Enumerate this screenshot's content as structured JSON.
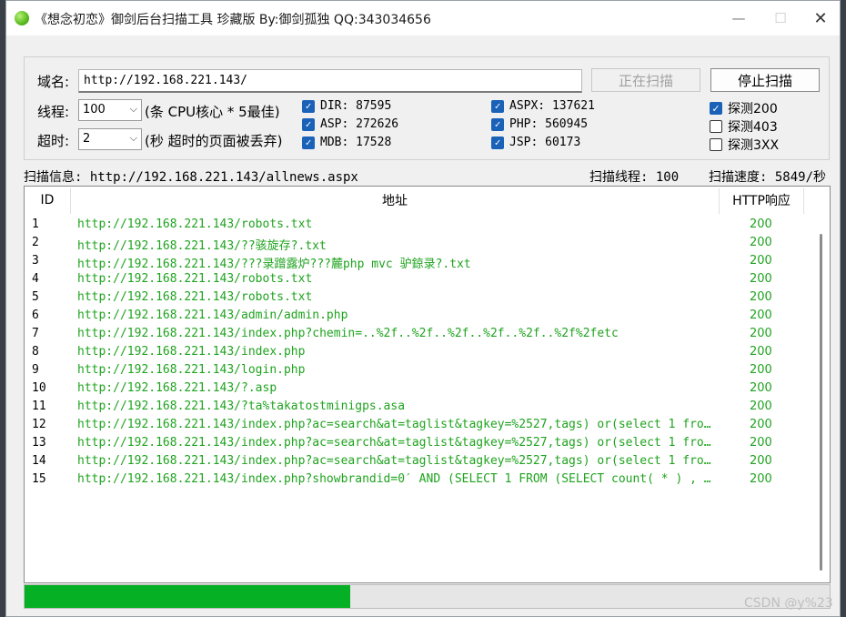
{
  "window": {
    "title": "《想念初恋》御剑后台扫描工具 珍藏版 By:御剑孤独 QQ:343034656",
    "min_symbol": "—",
    "max_symbol": "☐",
    "close_symbol": "✕"
  },
  "form": {
    "domain_label": "域名:",
    "domain_value": "http://192.168.221.143/",
    "scan_button": "正在扫描",
    "stop_button": "停止扫描",
    "threads_label": "线程:",
    "threads_value": "100",
    "threads_hint": "(条 CPU核心 * 5最佳)",
    "timeout_label": "超时:",
    "timeout_value": "2",
    "timeout_hint": "(秒 超时的页面被丢弃)"
  },
  "dictionaries": [
    {
      "label": "DIR: 87595",
      "checked": true
    },
    {
      "label": "ASP: 272626",
      "checked": true
    },
    {
      "label": "MDB: 17528",
      "checked": true
    },
    {
      "label": "ASPX: 137621",
      "checked": true
    },
    {
      "label": "PHP: 560945",
      "checked": true
    },
    {
      "label": "JSP: 60173",
      "checked": true
    }
  ],
  "detect_options": [
    {
      "label": "探测200",
      "checked": true
    },
    {
      "label": "探测403",
      "checked": false
    },
    {
      "label": "探测3XX",
      "checked": false
    }
  ],
  "status": {
    "info": "扫描信息: http://192.168.221.143/allnews.aspx",
    "threads": "扫描线程: 100",
    "speed": "扫描速度: 5849/秒"
  },
  "table": {
    "columns": [
      "ID",
      "地址",
      "HTTP响应"
    ],
    "rows": [
      {
        "id": "1",
        "url": "http://192.168.221.143/robots.txt",
        "code": "200"
      },
      {
        "id": "2",
        "url": "http://192.168.221.143/??骇旋存?.txt",
        "code": "200"
      },
      {
        "id": "3",
        "url": "http://192.168.221.143/???录蹭露炉???麓php mvc 驴鍄录?.txt",
        "code": "200"
      },
      {
        "id": "4",
        "url": "http://192.168.221.143/robots.txt",
        "code": "200"
      },
      {
        "id": "5",
        "url": "http://192.168.221.143/robots.txt",
        "code": "200"
      },
      {
        "id": "6",
        "url": "http://192.168.221.143/admin/admin.php",
        "code": "200"
      },
      {
        "id": "7",
        "url": "http://192.168.221.143/index.php?chemin=..%2f..%2f..%2f..%2f..%2f..%2f%2fetc",
        "code": "200"
      },
      {
        "id": "8",
        "url": "http://192.168.221.143/index.php",
        "code": "200"
      },
      {
        "id": "9",
        "url": "http://192.168.221.143/login.php",
        "code": "200"
      },
      {
        "id": "10",
        "url": "http://192.168.221.143/?.asp",
        "code": "200"
      },
      {
        "id": "11",
        "url": "http://192.168.221.143/?ta%takatostminigps.asa",
        "code": "200"
      },
      {
        "id": "12",
        "url": "http://192.168.221.143/index.php?ac=search&at=taglist&tagkey=%2527,tags) or(select 1 from(...",
        "code": "200"
      },
      {
        "id": "13",
        "url": "http://192.168.221.143/index.php?ac=search&at=taglist&tagkey=%2527,tags) or(select 1 from(...",
        "code": "200"
      },
      {
        "id": "14",
        "url": "http://192.168.221.143/index.php?ac=search&at=taglist&tagkey=%2527,tags) or(select 1 from(...",
        "code": "200"
      },
      {
        "id": "15",
        "url": "http://192.168.221.143/index.php?showbrandid=0′ AND (SELECT 1 FROM (SELECT count( * ) , c...",
        "code": "200"
      }
    ]
  },
  "progress": {
    "value": 0.405,
    "color": "#06b025"
  },
  "colors": {
    "url_green": "#1fa31f",
    "check_blue": "#1a62b8"
  },
  "watermark": "CSDN @y%23"
}
